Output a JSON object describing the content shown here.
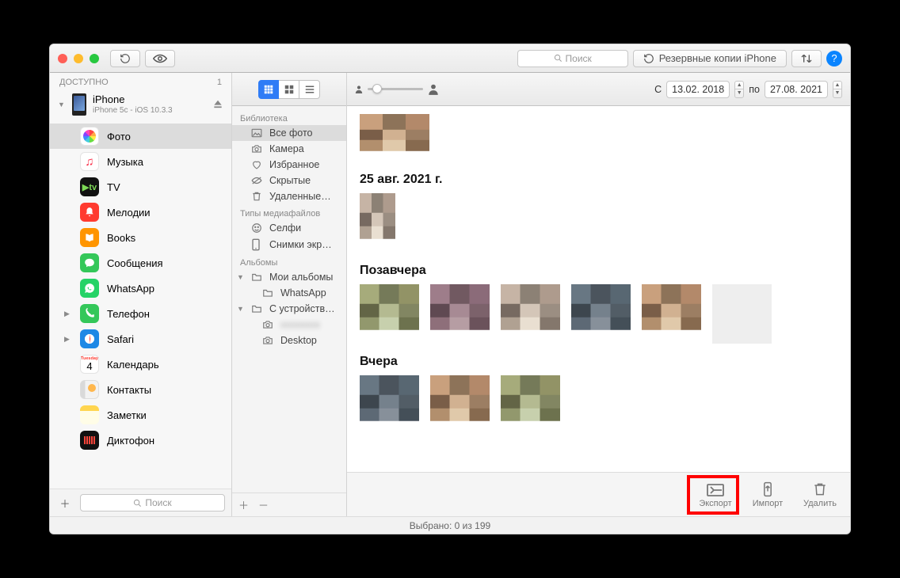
{
  "titlebar": {
    "search_placeholder": "Поиск",
    "backup_button_label": "Резервные копии iPhone"
  },
  "device_sidebar": {
    "section_label": "ДОСТУПНО",
    "section_count": "1",
    "device_name": "iPhone",
    "device_sub": "iPhone 5c - iOS 10.3.3",
    "items": [
      {
        "label": "Фото",
        "key": "photos"
      },
      {
        "label": "Музыка",
        "key": "music"
      },
      {
        "label": "TV",
        "key": "tv"
      },
      {
        "label": "Мелодии",
        "key": "ringtones"
      },
      {
        "label": "Books",
        "key": "books"
      },
      {
        "label": "Сообщения",
        "key": "messages"
      },
      {
        "label": "WhatsApp",
        "key": "whatsapp"
      },
      {
        "label": "Телефон",
        "key": "phone",
        "has_children": true
      },
      {
        "label": "Safari",
        "key": "safari",
        "has_children": true
      },
      {
        "label": "Календарь",
        "key": "calendar",
        "cal_day": "4",
        "cal_weekday": "Tuesday"
      },
      {
        "label": "Контакты",
        "key": "contacts"
      },
      {
        "label": "Заметки",
        "key": "notes"
      },
      {
        "label": "Диктофон",
        "key": "voice"
      }
    ],
    "search_placeholder": "Поиск"
  },
  "library": {
    "groups": [
      {
        "header": "Библиотека",
        "items": [
          {
            "label": "Все фото",
            "icon": "photos",
            "selected": true
          },
          {
            "label": "Камера",
            "icon": "camera"
          },
          {
            "label": "Избранное",
            "icon": "heart"
          },
          {
            "label": "Скрытые",
            "icon": "hidden"
          },
          {
            "label": "Удаленные…",
            "icon": "trash"
          }
        ]
      },
      {
        "header": "Типы медиафайлов",
        "items": [
          {
            "label": "Селфи",
            "icon": "selfie"
          },
          {
            "label": "Снимки экр…",
            "icon": "screenshot"
          }
        ]
      },
      {
        "header": "Альбомы",
        "items": [
          {
            "label": "Мои альбомы",
            "icon": "folder",
            "expandable": true
          },
          {
            "label": "WhatsApp",
            "icon": "folder",
            "indent": true
          },
          {
            "label": "С устройств…",
            "icon": "folder",
            "expandable": true
          },
          {
            "label": "",
            "icon": "camera",
            "indent": true,
            "redacted": true
          },
          {
            "label": "Desktop",
            "icon": "camera",
            "indent": true
          }
        ]
      }
    ]
  },
  "date_filter": {
    "from_label": "С",
    "from_value": "13.02. 2018",
    "to_label": "по",
    "to_value": "27.08. 2021"
  },
  "content": {
    "sections": [
      {
        "heading": "",
        "thumbs": 1,
        "first_wide": true
      },
      {
        "heading": "25 авг. 2021 г.",
        "thumbs": 1,
        "first_tall": true
      },
      {
        "heading": "Позавчера",
        "thumbs": 5,
        "with_blank": true
      },
      {
        "heading": "Вчера",
        "thumbs": 3
      }
    ]
  },
  "actions": {
    "export_label": "Экспорт",
    "import_label": "Импорт",
    "delete_label": "Удалить"
  },
  "status_bar": "Выбрано: 0 из 199"
}
